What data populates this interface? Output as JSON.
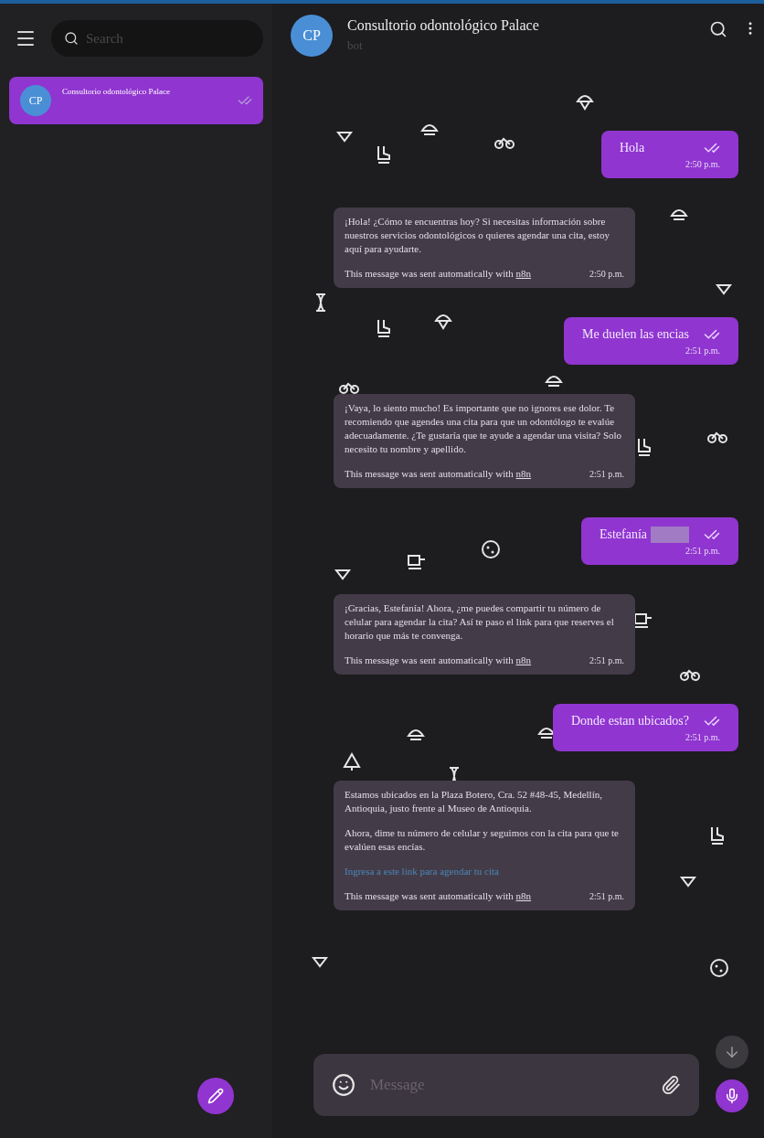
{
  "sidebar": {
    "search": {
      "placeholder": "Search"
    },
    "chats": [
      {
        "initials": "CP",
        "name": "Consultorio odontológico Palace",
        "selected": true,
        "read": true
      }
    ]
  },
  "chat": {
    "initials": "CP",
    "title": "Consultorio odontológico Palace",
    "subtitle": "bot"
  },
  "messages": [
    {
      "kind": "outgoing",
      "text": "Hola",
      "time": "2:50 p.m.",
      "read": true,
      "redacted": false
    },
    {
      "kind": "incoming",
      "paragraphs": [
        "¡Hola! ¿Cómo te encuentras hoy? Si necesitas información sobre nuestros servicios odontológicos o quieres agendar una cita, estoy aquí para ayudarte."
      ],
      "footer": "This message was sent automatically with",
      "footer_link": "n8n",
      "time": "2:50 p.m."
    },
    {
      "kind": "outgoing",
      "text": "Me duelen las encias",
      "time": "2:51 p.m.",
      "read": true,
      "redacted": false
    },
    {
      "kind": "incoming",
      "paragraphs": [
        "¡Vaya, lo siento mucho! Es importante que no ignores ese dolor. Te recomiendo que agendes una cita para que un odontólogo te evalúe adecuadamente. ¿Te gustaría que te ayude a agendar una visita? Solo necesito tu nombre y apellido."
      ],
      "footer": "This message was sent automatically with",
      "footer_link": "n8n",
      "time": "2:51 p.m."
    },
    {
      "kind": "outgoing",
      "text": "Estefanía",
      "time": "2:51 p.m.",
      "read": true,
      "redacted": true
    },
    {
      "kind": "incoming",
      "paragraphs": [
        "¡Gracias, Estefanía! Ahora, ¿me puedes compartir tu número de celular para agendar la cita? Así te paso el link para que reserves el horario que más te convenga."
      ],
      "footer": "This message was sent automatically with",
      "footer_link": "n8n",
      "time": "2:51 p.m."
    },
    {
      "kind": "outgoing",
      "text": "Donde estan ubicados?",
      "time": "2:51 p.m.",
      "read": true,
      "redacted": false
    },
    {
      "kind": "incoming",
      "paragraphs": [
        "Estamos ubicados en la Plaza Botero, Cra. 52 #48-45, Medellín, Antioquia, justo frente al Museo de Antioquia.",
        "Ahora, dime tu número de celular y seguimos con la cita para que te evalúen esas encías."
      ],
      "link": "Ingresa a este link para agendar tu cita",
      "footer": "This message was sent automatically with",
      "footer_link": "n8n",
      "time": "2:51 p.m."
    }
  ],
  "composer": {
    "placeholder": "Message"
  }
}
